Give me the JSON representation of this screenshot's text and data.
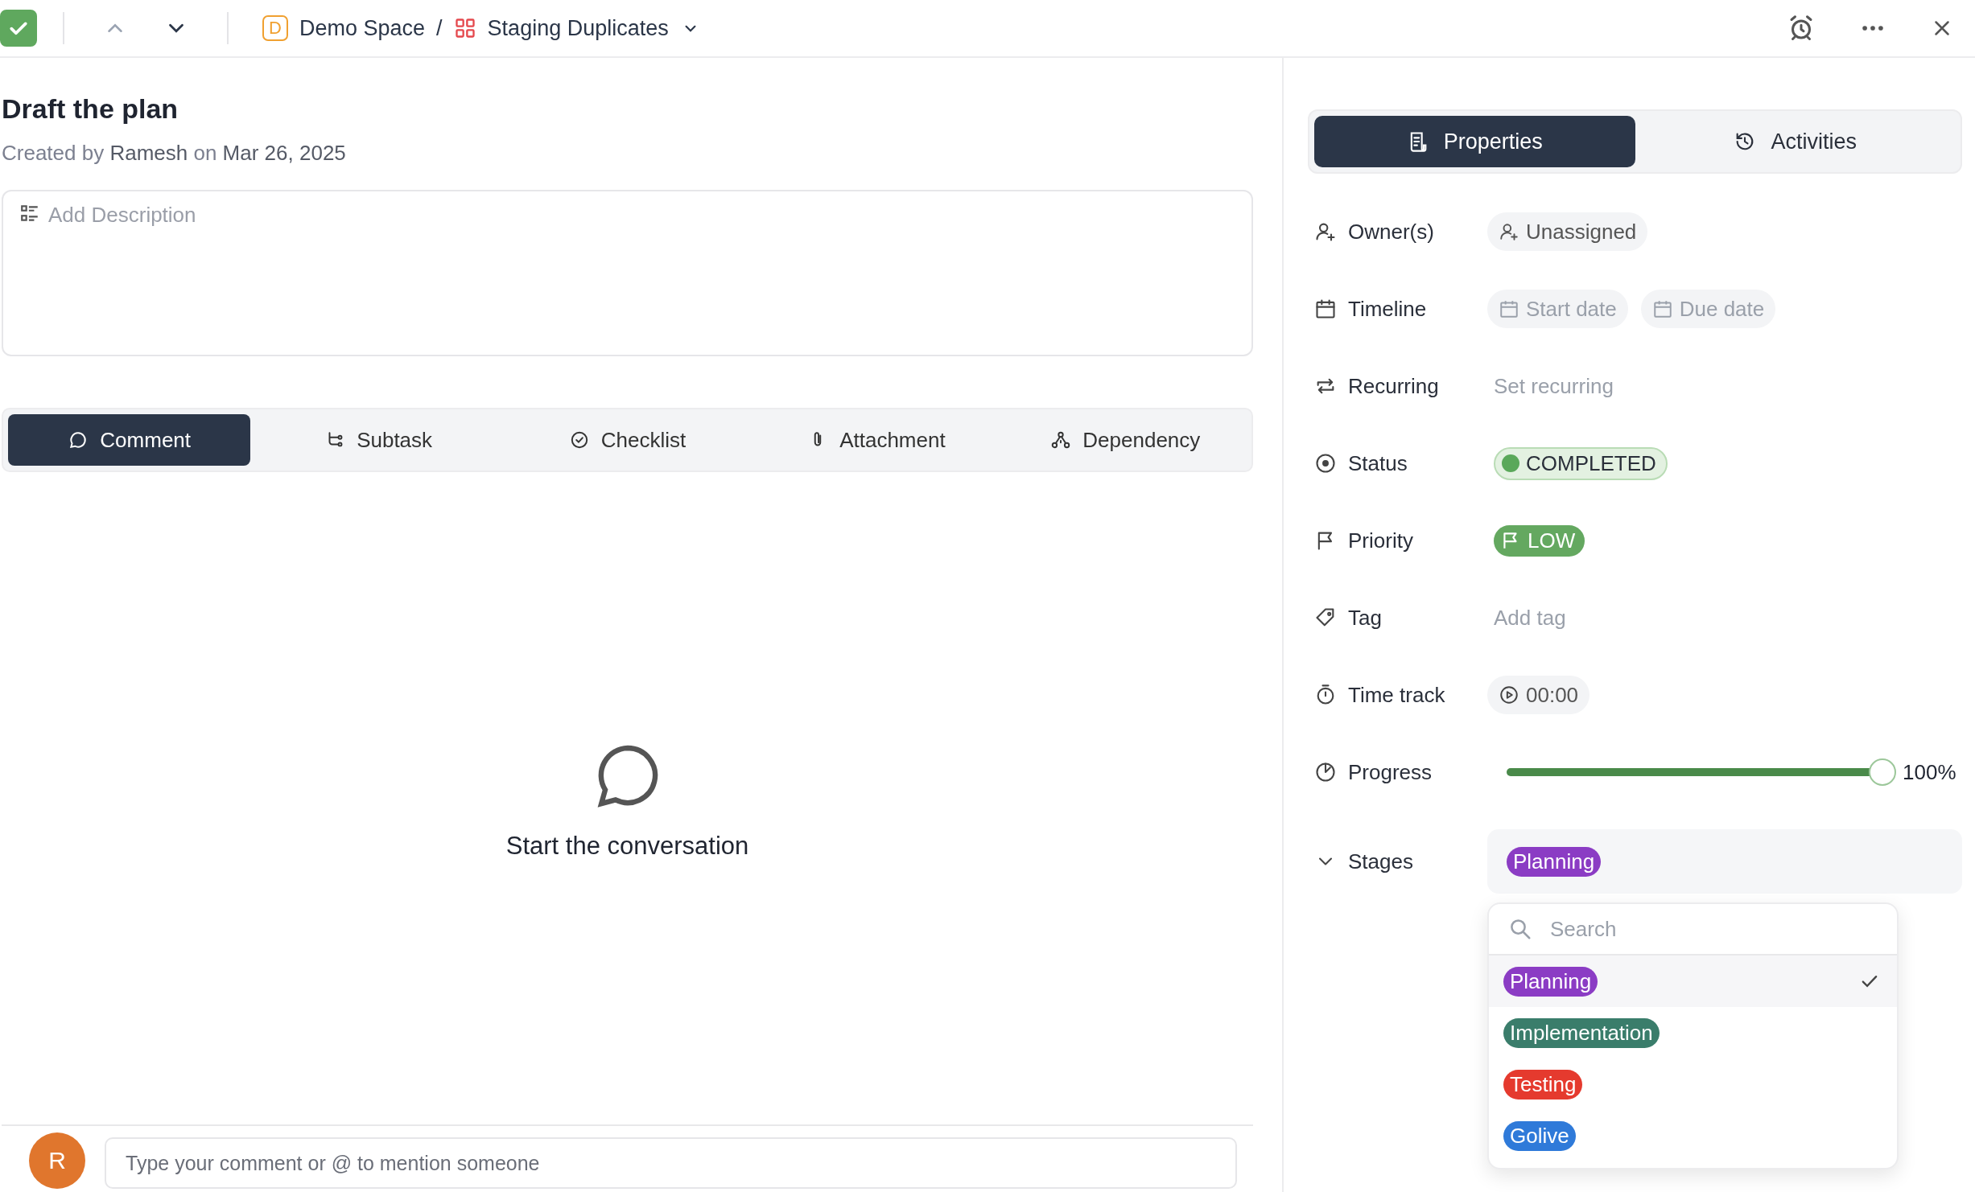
{
  "toolbar": {
    "completed": true,
    "space_badge": "D",
    "space": "Demo Space",
    "separator": "/",
    "project": "Staging Duplicates"
  },
  "task": {
    "title": "Draft the plan",
    "created_label": "Created by",
    "author": "Ramesh",
    "date_label": "on",
    "date": "Mar 26, 2025",
    "description_placeholder": "Add Description"
  },
  "tabs": [
    {
      "label": "Comment",
      "selected": true
    },
    {
      "label": "Subtask",
      "selected": false
    },
    {
      "label": "Checklist",
      "selected": false
    },
    {
      "label": "Attachment",
      "selected": false
    },
    {
      "label": "Dependency",
      "selected": false
    }
  ],
  "empty_state": {
    "text": "Start the conversation"
  },
  "comment": {
    "avatar": "R",
    "placeholder": "Type your comment or @ to mention someone"
  },
  "panel_tabs": [
    {
      "label": "Properties",
      "selected": true
    },
    {
      "label": "Activities",
      "selected": false
    }
  ],
  "properties": [
    {
      "kind": "owner",
      "label": "Owner(s)",
      "value": "Unassigned"
    },
    {
      "kind": "timeline",
      "label": "Timeline",
      "start": "Start date",
      "due": "Due date"
    },
    {
      "kind": "recurring",
      "label": "Recurring",
      "value": "Set recurring"
    },
    {
      "kind": "status",
      "label": "Status",
      "value": "COMPLETED",
      "color": "#5aa85a"
    },
    {
      "kind": "priority",
      "label": "Priority",
      "value": "LOW",
      "color": "#64a860"
    },
    {
      "kind": "tag",
      "label": "Tag",
      "value": "Add tag"
    },
    {
      "kind": "time",
      "label": "Time track",
      "value": "00:00"
    },
    {
      "kind": "progress",
      "label": "Progress",
      "level": 1,
      "reading": "100%"
    },
    {
      "kind": "stages",
      "label": "Stages",
      "expanded": true,
      "value": "Planning",
      "color": "#8b3cc4"
    }
  ],
  "stage_menu": {
    "search_placeholder": "Search",
    "options": [
      {
        "label": "Planning",
        "color": "#8b3cc4",
        "selected": true
      },
      {
        "label": "Implementation",
        "color": "#3a7d6b",
        "selected": false
      },
      {
        "label": "Testing",
        "color": "#e53a2e",
        "selected": false
      },
      {
        "label": "Golive",
        "color": "#2f7ad9",
        "selected": false
      }
    ]
  }
}
